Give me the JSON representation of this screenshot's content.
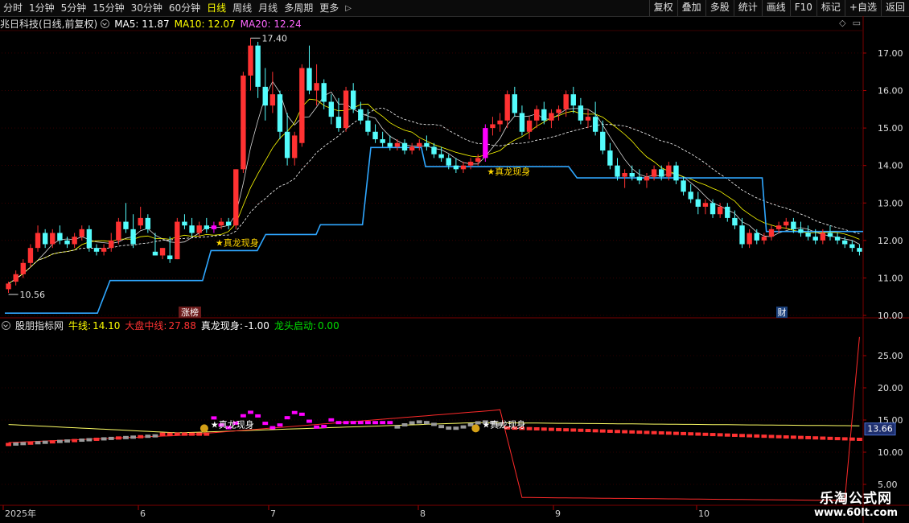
{
  "toolbar": {
    "periods": [
      "分时",
      "1分钟",
      "5分钟",
      "15分钟",
      "30分钟",
      "60分钟",
      "日线",
      "周线",
      "月线",
      "多周期",
      "更多"
    ],
    "active_period": "日线",
    "buttons": [
      "复权",
      "叠加",
      "多股",
      "统计",
      "画线",
      "F10",
      "标记",
      "+自选",
      "返回"
    ]
  },
  "colors": {
    "up": "#ff3232",
    "down": "#54fcfc",
    "ma5": "#ffffff",
    "ma10": "#ffff00",
    "ma20": "#ff00ff",
    "support": "#2fa7ff",
    "signal_bar": "#ff00ff",
    "gray_bar": "#9a9a9a",
    "yellow_line": "#ffff66",
    "red_line": "#ff2a2a",
    "text_gold": "#ffd700",
    "green": "#00e000",
    "grid": "#5a0000"
  },
  "main": {
    "stock_label": "兆日科技(日线,前复权)",
    "ma5": "MA5: 11.87",
    "ma10": "MA10: 12.07",
    "ma20": "MA20: 12.24",
    "y_labels": [
      "17.00",
      "16.00",
      "15.00",
      "14.00",
      "13.00",
      "12.00",
      "11.00",
      "10.00"
    ],
    "high_label": "17.40",
    "low_label": "10.56",
    "signal_text": "★真龙现身",
    "badge_zt": "涨榜",
    "badge_cai": "财"
  },
  "indicator": {
    "name": "股朋指标网",
    "niu_label": "牛线:",
    "niu_value": "14.10",
    "dapan_label": "大盘中线:",
    "dapan_value": "27.88",
    "zhenlong_label": "真龙现身:",
    "zhenlong_value": "-1.00",
    "longtou_label": "龙头启动:",
    "longtou_value": "0.00",
    "y_labels": [
      "25.00",
      "20.00",
      "15.00",
      "10.00",
      "5.00"
    ],
    "current_value": "13.66",
    "signal_text": "★真龙现身"
  },
  "x_axis": {
    "labels": [
      "2025年",
      "6",
      "7",
      "8",
      "9",
      "10"
    ]
  },
  "watermark": {
    "line1": "乐淘公式网",
    "line2": "www.60lt.com"
  },
  "chart_data": [
    {
      "type": "candlestick",
      "title": "兆日科技(日线,前复权)",
      "y_range": [
        10.0,
        17.6
      ],
      "highest": 17.4,
      "lowest": 10.56,
      "ma": {
        "MA5": 11.87,
        "MA10": 12.07,
        "MA20": 12.24
      },
      "candles_ohlc": [
        [
          10.7,
          10.9,
          10.6,
          10.85
        ],
        [
          10.9,
          11.2,
          10.8,
          11.1
        ],
        [
          11.1,
          11.5,
          11.0,
          11.4
        ],
        [
          11.4,
          11.9,
          11.3,
          11.8
        ],
        [
          11.8,
          12.4,
          11.7,
          12.2
        ],
        [
          12.2,
          12.3,
          11.8,
          11.9
        ],
        [
          11.9,
          12.3,
          11.8,
          12.2
        ],
        [
          12.2,
          12.4,
          11.9,
          12.0
        ],
        [
          12.0,
          12.1,
          11.8,
          11.9
        ],
        [
          11.9,
          12.2,
          11.8,
          12.1
        ],
        [
          12.1,
          12.4,
          12.0,
          12.3
        ],
        [
          12.3,
          12.4,
          11.7,
          11.8
        ],
        [
          11.8,
          11.9,
          11.6,
          11.7
        ],
        [
          11.7,
          11.9,
          11.6,
          11.8
        ],
        [
          11.8,
          12.2,
          11.7,
          12.0
        ],
        [
          12.0,
          12.6,
          11.9,
          12.5
        ],
        [
          12.5,
          13.0,
          12.2,
          12.3
        ],
        [
          12.3,
          12.7,
          11.8,
          11.9
        ],
        [
          12.4,
          12.9,
          12.3,
          12.6
        ],
        [
          12.6,
          12.7,
          12.2,
          12.3
        ],
        [
          11.7,
          12.2,
          11.6,
          11.6
        ],
        [
          11.6,
          11.8,
          11.5,
          11.8
        ],
        [
          11.6,
          12.1,
          11.4,
          11.5
        ],
        [
          11.5,
          12.6,
          11.5,
          12.5
        ],
        [
          12.5,
          12.7,
          12.3,
          12.4
        ],
        [
          12.4,
          12.6,
          12.1,
          12.2
        ],
        [
          12.2,
          12.5,
          12.1,
          12.4
        ],
        [
          12.4,
          12.6,
          12.2,
          12.3
        ],
        [
          12.3,
          12.5,
          12.2,
          12.4
        ],
        [
          12.4,
          12.6,
          12.3,
          12.5
        ],
        [
          12.5,
          12.6,
          12.3,
          12.4
        ],
        [
          12.4,
          13.9,
          12.3,
          13.9
        ],
        [
          13.9,
          16.5,
          13.8,
          16.4
        ],
        [
          16.4,
          17.4,
          16.0,
          17.2
        ],
        [
          17.2,
          17.3,
          15.8,
          16.1
        ],
        [
          16.1,
          16.6,
          15.2,
          15.6
        ],
        [
          15.6,
          16.5,
          15.4,
          15.9
        ],
        [
          15.9,
          16.0,
          14.7,
          14.9
        ],
        [
          14.9,
          15.4,
          14.0,
          14.2
        ],
        [
          14.2,
          14.9,
          14.0,
          14.8
        ],
        [
          14.6,
          16.7,
          14.5,
          16.6
        ],
        [
          16.6,
          17.2,
          15.9,
          16.0
        ],
        [
          16.0,
          16.7,
          15.6,
          16.2
        ],
        [
          16.2,
          16.3,
          15.5,
          15.7
        ],
        [
          15.7,
          15.9,
          15.1,
          15.3
        ],
        [
          15.3,
          15.8,
          14.9,
          15.0
        ],
        [
          15.0,
          16.1,
          14.9,
          16.0
        ],
        [
          16.0,
          16.2,
          15.4,
          15.5
        ],
        [
          15.5,
          15.7,
          15.1,
          15.2
        ],
        [
          15.2,
          15.5,
          14.8,
          14.9
        ],
        [
          14.9,
          15.1,
          14.6,
          14.7
        ],
        [
          14.7,
          14.9,
          14.5,
          14.6
        ],
        [
          14.6,
          14.8,
          14.4,
          14.5
        ],
        [
          14.5,
          14.7,
          14.4,
          14.6
        ],
        [
          14.6,
          14.7,
          14.3,
          14.4
        ],
        [
          14.4,
          14.6,
          14.3,
          14.5
        ],
        [
          14.5,
          14.7,
          14.4,
          14.6
        ],
        [
          14.6,
          14.8,
          14.4,
          14.5
        ],
        [
          14.5,
          14.6,
          14.2,
          14.3
        ],
        [
          14.3,
          14.5,
          14.1,
          14.2
        ],
        [
          14.2,
          14.3,
          13.9,
          14.0
        ],
        [
          14.0,
          14.2,
          13.8,
          13.9
        ],
        [
          13.9,
          14.1,
          13.8,
          14.0
        ],
        [
          14.0,
          14.2,
          13.9,
          14.1
        ],
        [
          14.1,
          14.3,
          14.0,
          14.2
        ],
        [
          14.2,
          15.1,
          14.1,
          15.0
        ],
        [
          15.0,
          15.3,
          14.8,
          15.1
        ],
        [
          15.1,
          15.4,
          14.9,
          15.2
        ],
        [
          15.2,
          16.0,
          15.0,
          15.9
        ],
        [
          15.9,
          16.1,
          15.3,
          15.4
        ],
        [
          15.4,
          15.6,
          14.8,
          14.9
        ],
        [
          14.9,
          15.3,
          14.7,
          15.2
        ],
        [
          15.2,
          15.6,
          15.0,
          15.5
        ],
        [
          15.5,
          15.7,
          15.1,
          15.2
        ],
        [
          15.2,
          15.5,
          15.0,
          15.4
        ],
        [
          15.4,
          15.6,
          15.2,
          15.5
        ],
        [
          15.5,
          16.0,
          15.3,
          15.9
        ],
        [
          15.9,
          16.1,
          15.4,
          15.6
        ],
        [
          15.6,
          15.8,
          15.1,
          15.2
        ],
        [
          15.2,
          15.5,
          15.0,
          15.3
        ],
        [
          15.3,
          15.7,
          14.8,
          14.9
        ],
        [
          14.9,
          15.2,
          14.3,
          14.4
        ],
        [
          14.4,
          14.6,
          13.9,
          14.0
        ],
        [
          14.0,
          14.2,
          13.6,
          13.7
        ],
        [
          13.7,
          13.9,
          13.4,
          13.8
        ],
        [
          13.8,
          14.0,
          13.6,
          13.7
        ],
        [
          13.7,
          13.9,
          13.5,
          13.6
        ],
        [
          13.6,
          13.8,
          13.4,
          13.7
        ],
        [
          13.7,
          14.0,
          13.6,
          13.9
        ],
        [
          13.9,
          14.0,
          13.6,
          13.7
        ],
        [
          13.7,
          14.1,
          13.6,
          14.0
        ],
        [
          14.0,
          14.1,
          13.5,
          13.6
        ],
        [
          13.6,
          13.7,
          13.2,
          13.3
        ],
        [
          13.3,
          13.5,
          13.0,
          13.1
        ],
        [
          13.1,
          13.3,
          12.7,
          12.9
        ],
        [
          12.9,
          13.1,
          12.7,
          13.0
        ],
        [
          13.0,
          13.1,
          12.6,
          12.7
        ],
        [
          12.7,
          13.0,
          12.6,
          12.9
        ],
        [
          12.9,
          13.0,
          12.5,
          12.6
        ],
        [
          12.6,
          12.8,
          12.3,
          12.4
        ],
        [
          12.4,
          12.6,
          11.8,
          11.9
        ],
        [
          11.9,
          12.3,
          11.8,
          12.2
        ],
        [
          12.2,
          12.3,
          11.9,
          12.0
        ],
        [
          12.0,
          12.2,
          11.9,
          12.1
        ],
        [
          12.1,
          12.4,
          12.0,
          12.3
        ],
        [
          12.3,
          12.5,
          12.2,
          12.4
        ],
        [
          12.4,
          12.6,
          12.3,
          12.5
        ],
        [
          12.5,
          12.6,
          12.2,
          12.3
        ],
        [
          12.3,
          12.5,
          12.1,
          12.2
        ],
        [
          12.2,
          12.4,
          12.0,
          12.1
        ],
        [
          12.1,
          12.3,
          11.9,
          12.0
        ],
        [
          12.0,
          12.3,
          11.9,
          12.2
        ],
        [
          12.2,
          12.4,
          12.0,
          12.1
        ],
        [
          12.1,
          12.2,
          11.9,
          12.0
        ],
        [
          12.0,
          12.1,
          11.8,
          11.9
        ],
        [
          11.9,
          12.0,
          11.7,
          11.8
        ],
        [
          11.8,
          11.9,
          11.6,
          11.7
        ]
      ],
      "support_line": [
        [
          0,
          10.06
        ],
        [
          22,
          10.06
        ],
        [
          25,
          10.93
        ],
        [
          47,
          10.93
        ],
        [
          49,
          11.73
        ],
        [
          56,
          11.73
        ],
        [
          60,
          11.73
        ],
        [
          62,
          12.16
        ],
        [
          74,
          12.16
        ],
        [
          75,
          12.42
        ],
        [
          85,
          12.42
        ],
        [
          87,
          14.48
        ],
        [
          99,
          14.48
        ],
        [
          100,
          13.97
        ],
        [
          134,
          13.97
        ],
        [
          136,
          13.67
        ],
        [
          180,
          13.67
        ],
        [
          181,
          12.24
        ],
        [
          204,
          12.24
        ]
      ],
      "signals": [
        {
          "candle": 28,
          "label": "★真龙现身"
        },
        {
          "candle": 65,
          "label": "★真龙现身"
        }
      ]
    },
    {
      "type": "line",
      "title": "股朋指标网",
      "y_range": [
        2.0,
        28.5
      ],
      "series": [
        {
          "name": "牛线",
          "value": 14.1
        },
        {
          "name": "大盘中线",
          "value": 27.88
        },
        {
          "name": "真龙现身",
          "value": -1.0
        },
        {
          "name": "龙头启动",
          "value": 0.0
        }
      ],
      "current": 13.66
    }
  ]
}
